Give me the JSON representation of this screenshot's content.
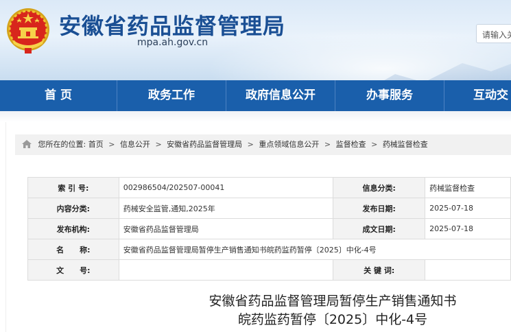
{
  "header": {
    "site_title": "安徽省药品监督管理局",
    "domain": "mpa.ah.gov.cn",
    "search_placeholder": "请输入关",
    "emblem_icon": "national-emblem-icon",
    "brand_color": "#1a4f94"
  },
  "nav": {
    "color": "#1a5fab",
    "items": [
      {
        "label": "首 页"
      },
      {
        "label": "政务工作"
      },
      {
        "label": "政府信息公开"
      },
      {
        "label": "办事服务"
      },
      {
        "label": "互动交"
      }
    ]
  },
  "breadcrumb": {
    "icon": "home-icon",
    "prefix": "您所在的位置:",
    "items": [
      "首页",
      "信息公开",
      "安徽省药品监督管理局",
      "重点领域信息公开",
      "监督检查",
      "药械监督检查"
    ],
    "separator": ">"
  },
  "info_table": {
    "index_label": "索 引 号:",
    "index_value": "002986504/202507-00041",
    "category_label": "信息分类:",
    "category_value": "药械监督检查",
    "content_label": "内容分类:",
    "content_value": "药械安全监管,通知,2025年",
    "publish_date_label": "发布日期:",
    "publish_date_value": "2025-07-18",
    "org_label": "发布机构:",
    "org_value": "安徽省药品监督管理局",
    "created_date_label": "成文日期:",
    "created_date_value": "2025-07-18",
    "name_label": "名      称:",
    "name_value": "安徽省药品监督管理局暂停生产销售通知书皖药监药暂停〔2025〕中化-4号",
    "docno_label": "文      号:",
    "docno_value": "",
    "keywords_label": "关 键 词:",
    "keywords_value": ""
  },
  "document": {
    "title_line1": "安徽省药品监督管理局暂停生产销售通知书",
    "title_line2": "皖药监药暂停〔2025〕中化-4号"
  }
}
